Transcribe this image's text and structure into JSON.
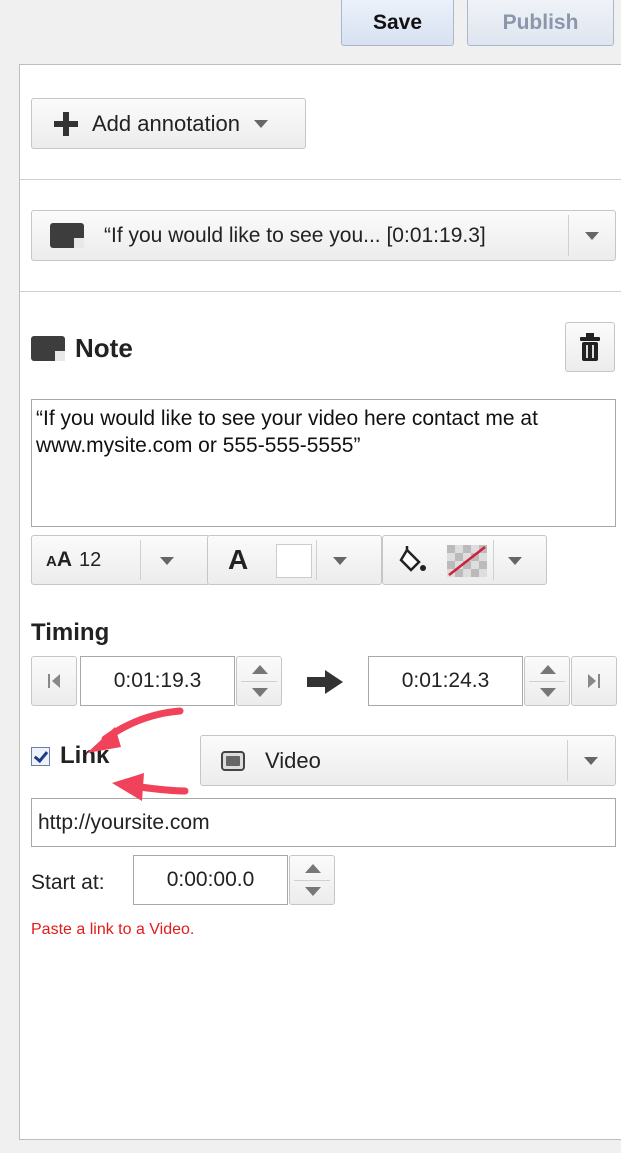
{
  "header": {
    "save_label": "Save",
    "publish_label": "Publish"
  },
  "add_annotation": {
    "label": "Add annotation",
    "icon": "plus-icon"
  },
  "annotation_select": {
    "value": "“If you would like to see you... [0:01:19.3]",
    "icon": "note-icon"
  },
  "note": {
    "title": "Note",
    "text": "“If you would like to see your video here contact me at www.mysite.com or 555-555-5555”"
  },
  "format": {
    "font_size": "12"
  },
  "timing": {
    "label": "Timing",
    "start": "0:01:19.3",
    "end": "0:01:24.3"
  },
  "link": {
    "label": "Link",
    "checked": true,
    "type": "Video",
    "url": "http://yoursite.com"
  },
  "start_at": {
    "label": "Start at:",
    "value": "0:00:00.0"
  },
  "error": "Paste a link to a Video.",
  "colors": {
    "error": "#e21b1b",
    "arrow": "#f0425a",
    "accent_button": "#d7e1f1"
  }
}
